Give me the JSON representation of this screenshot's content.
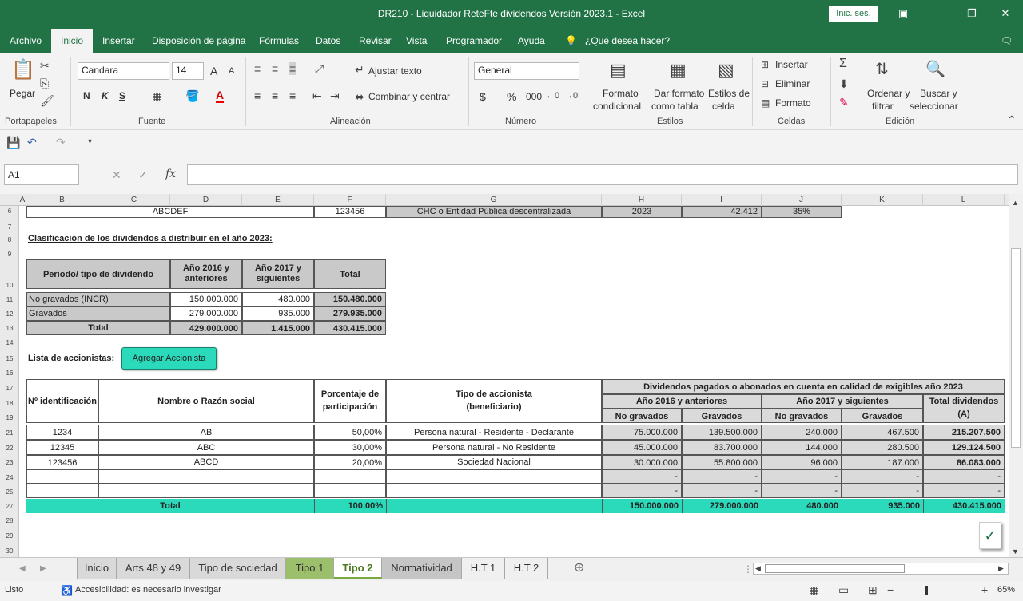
{
  "window": {
    "title": "DR210 - Liquidador ReteFte dividendos Versión 2023.1  -  Excel",
    "signin": "Inic. ses."
  },
  "menu": {
    "items": [
      "Archivo",
      "Inicio",
      "Insertar",
      "Disposición de página",
      "Fórmulas",
      "Datos",
      "Revisar",
      "Vista",
      "Programador",
      "Ayuda"
    ],
    "tell": "¿Qué desea hacer?"
  },
  "ribbon": {
    "clipboard": {
      "paste": "Pegar",
      "label": "Portapapeles"
    },
    "font": {
      "name": "Candara",
      "size": "14",
      "bold": "N",
      "italic": "K",
      "underline": "S",
      "grow": "A",
      "shrink": "A",
      "label": "Fuente"
    },
    "alignment": {
      "wrap": "Ajustar texto",
      "merge": "Combinar y centrar",
      "label": "Alineación"
    },
    "number": {
      "format": "General",
      "currency": "$",
      "percent": "%",
      "thousands": "000",
      "label": "Número"
    },
    "styles": {
      "cond1": "Formato",
      "cond2": "condicional",
      "table1": "Dar formato",
      "table2": "como tabla",
      "cell1": "Estilos de",
      "cell2": "celda",
      "label": "Estilos"
    },
    "cells": {
      "insert": "Insertar",
      "delete": "Eliminar",
      "format": "Formato",
      "label": "Celdas"
    },
    "editing": {
      "sort1": "Ordenar y",
      "sort2": "filtrar",
      "find1": "Buscar y",
      "find2": "seleccionar",
      "label": "Edición"
    }
  },
  "formula": {
    "namebox": "A1",
    "value": ""
  },
  "columns": [
    "A",
    "B",
    "C",
    "D",
    "E",
    "F",
    "G",
    "H",
    "I",
    "J",
    "K",
    "L"
  ],
  "rows": [
    "6",
    "7",
    "8",
    "9",
    "10",
    "11",
    "12",
    "13",
    "14",
    "15",
    "16",
    "17",
    "18",
    "19",
    "21",
    "22",
    "23",
    "24",
    "25",
    "27",
    "28",
    "29",
    "30"
  ],
  "sheet": {
    "r6": {
      "name": "ABCDEF",
      "nit": "123456",
      "type": "CHC o Entidad Pública descentralizada",
      "year": "2023",
      "uvt": "42.412",
      "rate": "35%"
    },
    "class_title": "Clasificación de los dividendos a distribuir en el año 2023:",
    "class_table": {
      "headers": [
        "Periodo/ tipo de dividendo",
        "Año 2016 y anteriores",
        "Año 2017 y siguientes",
        "Total"
      ],
      "rows": [
        [
          "No gravados (INCR)",
          "150.000.000",
          "480.000",
          "150.480.000"
        ],
        [
          "Gravados",
          "279.000.000",
          "935.000",
          "279.935.000"
        ],
        [
          "Total",
          "429.000.000",
          "1.415.000",
          "430.415.000"
        ]
      ]
    },
    "list_title": "Lista de accionistas:",
    "add_button": "Agregar Accionista",
    "sh_headers": {
      "id": "Nº identificación",
      "name": "Nombre o Razón social",
      "pct1": "Porcentaje de",
      "pct2": "participación",
      "type1": "Tipo de accionista",
      "type2": "(beneficiario)",
      "div": "Dividendos pagados o abonados en cuenta en calidad de exigibles año 2023",
      "y2016": "Año 2016 y anteriores",
      "y2017": "Año 2017 y siguientes",
      "total1": "Total dividendos",
      "total2": "(A)",
      "ng": "No gravados",
      "g": "Gravados"
    },
    "shareholders": [
      [
        "1234",
        "AB",
        "50,00%",
        "Persona natural - Residente - Declarante",
        "75.000.000",
        "139.500.000",
        "240.000",
        "467.500",
        "215.207.500"
      ],
      [
        "12345",
        "ABC",
        "30,00%",
        "Persona natural - No Residente",
        "45.000.000",
        "83.700.000",
        "144.000",
        "280.500",
        "129.124.500"
      ],
      [
        "123456",
        "ABCD",
        "20,00%",
        "Sociedad Nacional",
        "30.000.000",
        "55.800.000",
        "96.000",
        "187.000",
        "86.083.000"
      ],
      [
        "",
        "",
        "",
        "",
        "-",
        "-",
        "-",
        "-",
        "-"
      ],
      [
        "",
        "",
        "",
        "",
        "-",
        "-",
        "-",
        "-",
        "-"
      ]
    ],
    "total_row": [
      "Total",
      "100,00%",
      "150.000.000",
      "279.000.000",
      "480.000",
      "935.000",
      "430.415.000"
    ]
  },
  "tabs": [
    "Inicio",
    "Arts 48 y 49",
    "Tipo de sociedad",
    "Tipo 1",
    "Tipo 2",
    "Normatividad",
    "H.T 1",
    "H.T 2"
  ],
  "status": {
    "ready": "Listo",
    "accessibility": "Accesibilidad: es necesario investigar",
    "zoom": "65%"
  },
  "colors": {
    "excel_green": "#217346",
    "teal": "#2bd9bb",
    "gray": "#c9c9c9"
  }
}
